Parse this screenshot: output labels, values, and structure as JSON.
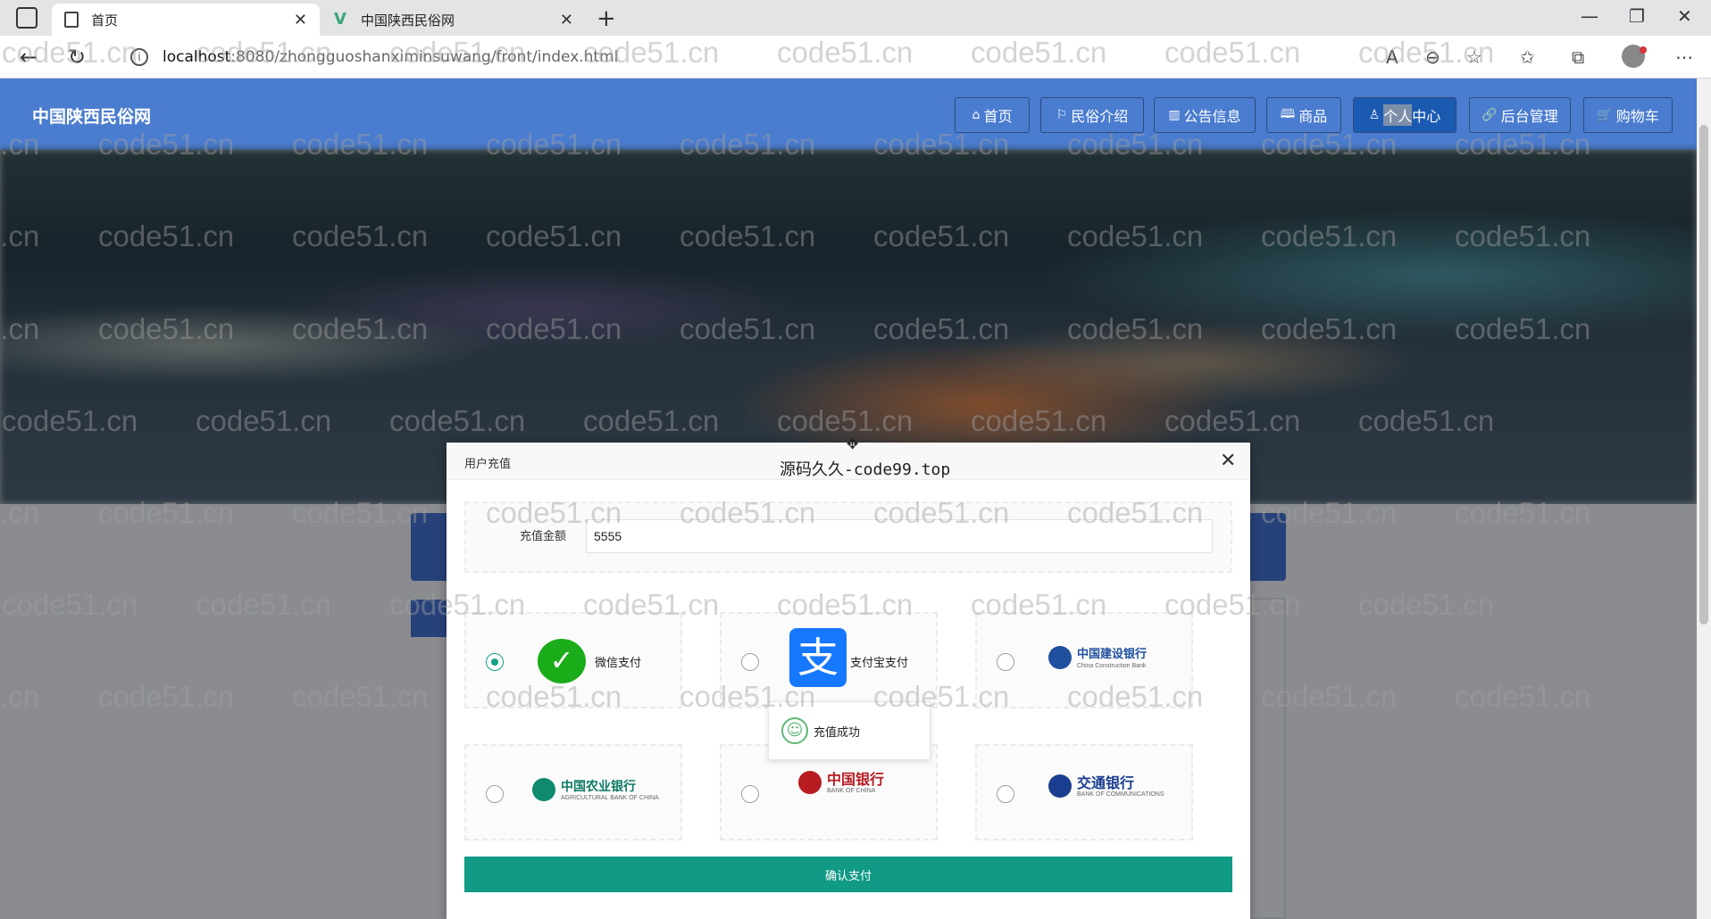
{
  "browser": {
    "tabs": [
      {
        "title": "首页",
        "active": true
      },
      {
        "title": "中国陕西民俗网",
        "active": false
      }
    ],
    "url_host": "localhost",
    "url_path": ":8080/zhongguoshanximinsuwang/front/index.html"
  },
  "site": {
    "title": "中国陕西民俗网",
    "nav": [
      {
        "icon": "⌂",
        "label": "首页"
      },
      {
        "icon": "⚐",
        "label": "民俗介绍"
      },
      {
        "icon": "▥",
        "label": "公告信息"
      },
      {
        "icon": "🕮",
        "label": "商品"
      },
      {
        "icon": "♙",
        "label_pre": "",
        "label_sel": "个人",
        "label_post": "中心",
        "active": true
      },
      {
        "icon": "🔗",
        "label": "后台管理"
      },
      {
        "icon": "🛒",
        "label": "购物车"
      }
    ]
  },
  "modal": {
    "title": "用户充值",
    "overlay_text": "源码久久-code99.top",
    "amount_label": "充值金额",
    "amount_value": "5555",
    "payment_methods": [
      {
        "name": "wechat",
        "label": "微信支付",
        "selected": true
      },
      {
        "name": "alipay",
        "label": "支付宝支付",
        "selected": false
      },
      {
        "name": "ccb",
        "label": "中国建设银行",
        "sub": "China Construction Bank",
        "selected": false
      },
      {
        "name": "abc",
        "label": "中国农业银行",
        "sub": "AGRICULTURAL BANK OF CHINA",
        "selected": false
      },
      {
        "name": "boc",
        "label": "中国银行",
        "sub": "BANK OF CHINA",
        "selected": false
      },
      {
        "name": "bocom",
        "label": "交通银行",
        "sub": "BANK OF COMMUNICATIONS",
        "selected": false
      }
    ],
    "toast_text": "充值成功",
    "confirm_label": "确认支付"
  },
  "watermark": "code51.cn",
  "colors": {
    "header": "#4a7ccf",
    "nav_active": "#1b5ab1",
    "confirm": "#119a86",
    "wechat": "#1aad19",
    "alipay": "#1677ff"
  }
}
